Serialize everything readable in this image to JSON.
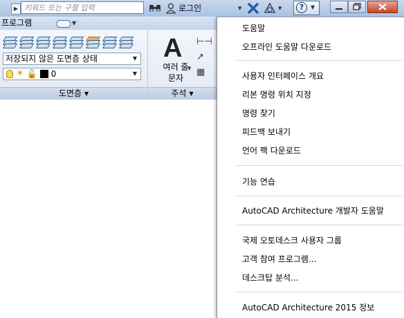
{
  "titlebar": {
    "search_placeholder": "키워드 또는 구절 입력",
    "login_label": "로그인"
  },
  "ribbon": {
    "tab_label": "프로그램",
    "layers_panel": {
      "layer_state_value": "저장되지 않은 도면층 상태",
      "current_layer_value": "0",
      "footer_label": "도면층"
    },
    "annotation_panel": {
      "big_icon_glyph": "A",
      "multiline_text_label_line1": "여러 줄",
      "multiline_text_label_line2": "문자",
      "footer_label": "주석"
    }
  },
  "help_menu": {
    "items": [
      {
        "label": "도움말"
      },
      {
        "label": "오프라인 도움말 다운로드"
      },
      {
        "label": "사용자 인터페이스 개요"
      },
      {
        "label": "리본 명령 위치 지정"
      },
      {
        "label": "명령 찾기"
      },
      {
        "label": "피드백 보내기"
      },
      {
        "label": "언어 팩 다운로드"
      },
      {
        "label": "기능 연습"
      },
      {
        "label": "AutoCAD Architecture 개발자 도움말"
      },
      {
        "label": "국제 오토데스크 사용자 그룹"
      },
      {
        "label": "고객 참여 프로그램..."
      },
      {
        "label": "데스크탑 분석..."
      },
      {
        "label": "AutoCAD Architecture 2015 정보"
      }
    ]
  },
  "icons": {
    "search": "search-icon",
    "binoculars": "binoculars-icon",
    "user": "user-icon",
    "exchange": "autodesk-exchange-icon",
    "a360": "a360-icon",
    "help": "help-icon",
    "bulb": "lightbulb-icon",
    "sun": "sun-icon",
    "lock": "lock-icon"
  },
  "colors": {
    "titlebar": "#b8cde8",
    "close_button": "#c6452b",
    "layer_color": "#000000"
  }
}
